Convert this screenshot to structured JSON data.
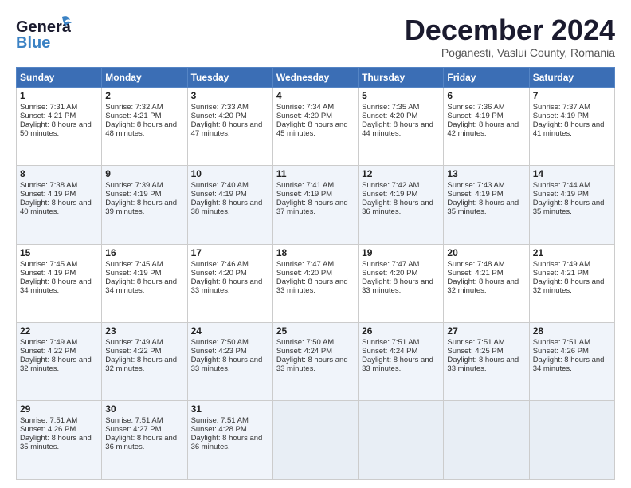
{
  "header": {
    "logo_line1": "General",
    "logo_line2": "Blue",
    "month_title": "December 2024",
    "subtitle": "Poganesti, Vaslui County, Romania"
  },
  "days_of_week": [
    "Sunday",
    "Monday",
    "Tuesday",
    "Wednesday",
    "Thursday",
    "Friday",
    "Saturday"
  ],
  "weeks": [
    [
      {
        "day": "1",
        "sunrise": "Sunrise: 7:31 AM",
        "sunset": "Sunset: 4:21 PM",
        "daylight": "Daylight: 8 hours and 50 minutes."
      },
      {
        "day": "2",
        "sunrise": "Sunrise: 7:32 AM",
        "sunset": "Sunset: 4:21 PM",
        "daylight": "Daylight: 8 hours and 48 minutes."
      },
      {
        "day": "3",
        "sunrise": "Sunrise: 7:33 AM",
        "sunset": "Sunset: 4:20 PM",
        "daylight": "Daylight: 8 hours and 47 minutes."
      },
      {
        "day": "4",
        "sunrise": "Sunrise: 7:34 AM",
        "sunset": "Sunset: 4:20 PM",
        "daylight": "Daylight: 8 hours and 45 minutes."
      },
      {
        "day": "5",
        "sunrise": "Sunrise: 7:35 AM",
        "sunset": "Sunset: 4:20 PM",
        "daylight": "Daylight: 8 hours and 44 minutes."
      },
      {
        "day": "6",
        "sunrise": "Sunrise: 7:36 AM",
        "sunset": "Sunset: 4:19 PM",
        "daylight": "Daylight: 8 hours and 42 minutes."
      },
      {
        "day": "7",
        "sunrise": "Sunrise: 7:37 AM",
        "sunset": "Sunset: 4:19 PM",
        "daylight": "Daylight: 8 hours and 41 minutes."
      }
    ],
    [
      {
        "day": "8",
        "sunrise": "Sunrise: 7:38 AM",
        "sunset": "Sunset: 4:19 PM",
        "daylight": "Daylight: 8 hours and 40 minutes."
      },
      {
        "day": "9",
        "sunrise": "Sunrise: 7:39 AM",
        "sunset": "Sunset: 4:19 PM",
        "daylight": "Daylight: 8 hours and 39 minutes."
      },
      {
        "day": "10",
        "sunrise": "Sunrise: 7:40 AM",
        "sunset": "Sunset: 4:19 PM",
        "daylight": "Daylight: 8 hours and 38 minutes."
      },
      {
        "day": "11",
        "sunrise": "Sunrise: 7:41 AM",
        "sunset": "Sunset: 4:19 PM",
        "daylight": "Daylight: 8 hours and 37 minutes."
      },
      {
        "day": "12",
        "sunrise": "Sunrise: 7:42 AM",
        "sunset": "Sunset: 4:19 PM",
        "daylight": "Daylight: 8 hours and 36 minutes."
      },
      {
        "day": "13",
        "sunrise": "Sunrise: 7:43 AM",
        "sunset": "Sunset: 4:19 PM",
        "daylight": "Daylight: 8 hours and 35 minutes."
      },
      {
        "day": "14",
        "sunrise": "Sunrise: 7:44 AM",
        "sunset": "Sunset: 4:19 PM",
        "daylight": "Daylight: 8 hours and 35 minutes."
      }
    ],
    [
      {
        "day": "15",
        "sunrise": "Sunrise: 7:45 AM",
        "sunset": "Sunset: 4:19 PM",
        "daylight": "Daylight: 8 hours and 34 minutes."
      },
      {
        "day": "16",
        "sunrise": "Sunrise: 7:45 AM",
        "sunset": "Sunset: 4:19 PM",
        "daylight": "Daylight: 8 hours and 34 minutes."
      },
      {
        "day": "17",
        "sunrise": "Sunrise: 7:46 AM",
        "sunset": "Sunset: 4:20 PM",
        "daylight": "Daylight: 8 hours and 33 minutes."
      },
      {
        "day": "18",
        "sunrise": "Sunrise: 7:47 AM",
        "sunset": "Sunset: 4:20 PM",
        "daylight": "Daylight: 8 hours and 33 minutes."
      },
      {
        "day": "19",
        "sunrise": "Sunrise: 7:47 AM",
        "sunset": "Sunset: 4:20 PM",
        "daylight": "Daylight: 8 hours and 33 minutes."
      },
      {
        "day": "20",
        "sunrise": "Sunrise: 7:48 AM",
        "sunset": "Sunset: 4:21 PM",
        "daylight": "Daylight: 8 hours and 32 minutes."
      },
      {
        "day": "21",
        "sunrise": "Sunrise: 7:49 AM",
        "sunset": "Sunset: 4:21 PM",
        "daylight": "Daylight: 8 hours and 32 minutes."
      }
    ],
    [
      {
        "day": "22",
        "sunrise": "Sunrise: 7:49 AM",
        "sunset": "Sunset: 4:22 PM",
        "daylight": "Daylight: 8 hours and 32 minutes."
      },
      {
        "day": "23",
        "sunrise": "Sunrise: 7:49 AM",
        "sunset": "Sunset: 4:22 PM",
        "daylight": "Daylight: 8 hours and 32 minutes."
      },
      {
        "day": "24",
        "sunrise": "Sunrise: 7:50 AM",
        "sunset": "Sunset: 4:23 PM",
        "daylight": "Daylight: 8 hours and 33 minutes."
      },
      {
        "day": "25",
        "sunrise": "Sunrise: 7:50 AM",
        "sunset": "Sunset: 4:24 PM",
        "daylight": "Daylight: 8 hours and 33 minutes."
      },
      {
        "day": "26",
        "sunrise": "Sunrise: 7:51 AM",
        "sunset": "Sunset: 4:24 PM",
        "daylight": "Daylight: 8 hours and 33 minutes."
      },
      {
        "day": "27",
        "sunrise": "Sunrise: 7:51 AM",
        "sunset": "Sunset: 4:25 PM",
        "daylight": "Daylight: 8 hours and 33 minutes."
      },
      {
        "day": "28",
        "sunrise": "Sunrise: 7:51 AM",
        "sunset": "Sunset: 4:26 PM",
        "daylight": "Daylight: 8 hours and 34 minutes."
      }
    ],
    [
      {
        "day": "29",
        "sunrise": "Sunrise: 7:51 AM",
        "sunset": "Sunset: 4:26 PM",
        "daylight": "Daylight: 8 hours and 35 minutes."
      },
      {
        "day": "30",
        "sunrise": "Sunrise: 7:51 AM",
        "sunset": "Sunset: 4:27 PM",
        "daylight": "Daylight: 8 hours and 36 minutes."
      },
      {
        "day": "31",
        "sunrise": "Sunrise: 7:51 AM",
        "sunset": "Sunset: 4:28 PM",
        "daylight": "Daylight: 8 hours and 36 minutes."
      },
      null,
      null,
      null,
      null
    ]
  ]
}
